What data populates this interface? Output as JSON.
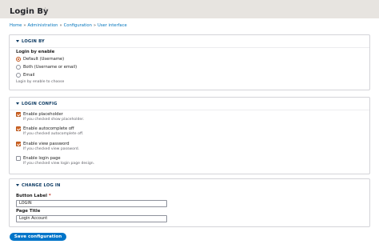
{
  "page": {
    "title": "Login By"
  },
  "breadcrumb": [
    {
      "label": "Home"
    },
    {
      "label": "Administration"
    },
    {
      "label": "Configuration"
    },
    {
      "label": "User interface"
    }
  ],
  "breadcrumb_separator": "»",
  "login_by": {
    "legend": "LOGIN BY",
    "field_label": "Login by enable",
    "options": [
      {
        "label": "Default (Username)",
        "selected": true
      },
      {
        "label": "Both (Username or email)",
        "selected": false
      },
      {
        "label": "Email",
        "selected": false
      }
    ],
    "description": "Login by enable to choose"
  },
  "login_config": {
    "legend": "LOGIN CONFIG",
    "items": [
      {
        "label": "Enable placeholder",
        "description": "If you checked show placeholder.",
        "checked": true
      },
      {
        "label": "Enable autocomplete off",
        "description": "If you checked autocomplete off.",
        "checked": true
      },
      {
        "label": "Enable view password",
        "description": "If you checked view password.",
        "checked": true
      },
      {
        "label": "Enable login page",
        "description": "If you checked view login page design.",
        "checked": false
      }
    ]
  },
  "change_log_in": {
    "legend": "CHANGE LOG IN",
    "button_label": {
      "label": "Button Label",
      "required_marker": "*",
      "value": "LOGIN"
    },
    "page_title": {
      "label": "Page Title",
      "value": "Login Account"
    }
  },
  "actions": {
    "save_label": "Save configuration"
  },
  "colors": {
    "accent": "#0075c9",
    "checked": "#d36a2a",
    "link": "#0074bd"
  }
}
